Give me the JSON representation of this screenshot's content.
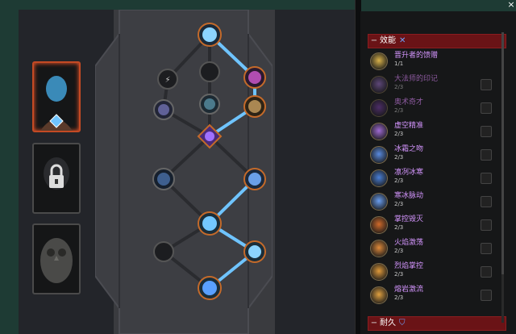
{
  "close_label": "×",
  "portraits": [
    {
      "name": "hero-portrait-active",
      "state": "active"
    },
    {
      "name": "hero-portrait-locked",
      "state": "locked"
    },
    {
      "name": "hero-portrait-owl",
      "state": "inactive"
    }
  ],
  "panel": {
    "sections": [
      {
        "title": "效能",
        "rows": [
          {
            "name": "晋升者的馈赠",
            "count": "1/1",
            "color": "#d9b24a",
            "dim": false
          },
          {
            "name": "大法师的印记",
            "count": "2/3",
            "color": "#9a6fc8",
            "dim": true
          },
          {
            "name": "奥术奇才",
            "count": "2/3",
            "color": "#7a3fa8",
            "dim": true
          },
          {
            "name": "虚空精准",
            "count": "2/3",
            "color": "#a06bd4",
            "dim": false
          },
          {
            "name": "冰霜之吻",
            "count": "2/3",
            "color": "#5a8be0",
            "dim": false
          },
          {
            "name": "凛冽冰寒",
            "count": "2/3",
            "color": "#4a7fd6",
            "dim": false
          },
          {
            "name": "寒冰脉动",
            "count": "2/3",
            "color": "#6a9ef0",
            "dim": false
          },
          {
            "name": "掌控毁灭",
            "count": "2/3",
            "color": "#d06a2a",
            "dim": false
          },
          {
            "name": "火焰激荡",
            "count": "2/3",
            "color": "#e08a3a",
            "dim": false
          },
          {
            "name": "烈焰掌控",
            "count": "2/3",
            "color": "#e09a3a",
            "dim": false
          },
          {
            "name": "熔岩激流",
            "count": "2/3",
            "color": "#e0a040",
            "dim": false
          }
        ]
      },
      {
        "title": "耐久",
        "rows": []
      }
    ]
  }
}
